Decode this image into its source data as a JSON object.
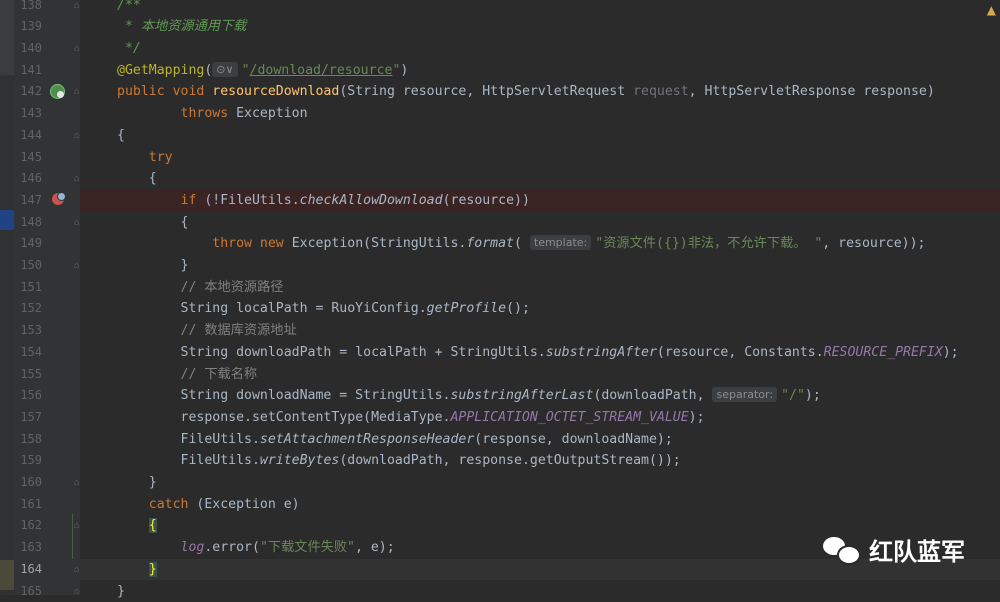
{
  "editor": {
    "lines": [
      {
        "n": "138",
        "html": "<span class=\"cmt\">/**</span>"
      },
      {
        "n": "139",
        "html": "<span class=\"cmt\"> * 本地资源通用下载</span>"
      },
      {
        "n": "140",
        "html": "<span class=\"cmt\"> */</span>"
      },
      {
        "n": "141",
        "html": "<span class=\"ann\">@GetMapping</span>(<span class=\"hint\">⊙∨</span><span class=\"str\">\"</span><span class=\"link\">/download/resource</span><span class=\"str\">\"</span>)"
      },
      {
        "n": "142",
        "html": "<span class=\"kw\">public void </span><span class=\"fn\">resourceDownload</span>(String resource, HttpServletRequest <span class=\"param\">request</span>, HttpServletResponse response)"
      },
      {
        "n": "143",
        "html": "        <span class=\"kw\">throws </span>Exception"
      },
      {
        "n": "144",
        "html": "{"
      },
      {
        "n": "145",
        "html": "    <span class=\"kw\">try</span>"
      },
      {
        "n": "146",
        "html": "    {"
      },
      {
        "n": "147",
        "html": "        <span class=\"kw\">if </span>(!FileUtils.<span class=\"it\">checkAllowDownload</span>(resource))"
      },
      {
        "n": "148",
        "html": "        {"
      },
      {
        "n": "149",
        "html": "            <span class=\"kw\">throw new </span>Exception(StringUtils.<span class=\"it\">format</span>( <span class=\"hint\">template:</span><span class=\"str\">\"资源文件({})非法，不允许下载。 \"</span>, resource));"
      },
      {
        "n": "150",
        "html": "        }"
      },
      {
        "n": "151",
        "html": "        <span class=\"lcmt\">// 本地资源路径</span>"
      },
      {
        "n": "152",
        "html": "        String localPath = RuoYiConfig.<span class=\"it\">getProfile</span>();"
      },
      {
        "n": "153",
        "html": "        <span class=\"lcmt\">// 数据库资源地址</span>"
      },
      {
        "n": "154",
        "html": "        String downloadPath = localPath + StringUtils.<span class=\"it\">substringAfter</span>(resource, Constants.<span class=\"const\">RESOURCE_PREFIX</span>);"
      },
      {
        "n": "155",
        "html": "        <span class=\"lcmt\">// 下载名称</span>"
      },
      {
        "n": "156",
        "html": "        String downloadName = StringUtils.<span class=\"it\">substringAfterLast</span>(downloadPath, <span class=\"hint\">separator:</span><span class=\"str\">\"/\"</span>);"
      },
      {
        "n": "157",
        "html": "        response.setContentType(MediaType.<span class=\"const\">APPLICATION_OCTET_STREAM_VALUE</span>);"
      },
      {
        "n": "158",
        "html": "        FileUtils.<span class=\"it\">setAttachmentResponseHeader</span>(response, downloadName);"
      },
      {
        "n": "159",
        "html": "        FileUtils.<span class=\"it\">writeBytes</span>(downloadPath, response.getOutputStream());"
      },
      {
        "n": "160",
        "html": "    }"
      },
      {
        "n": "161",
        "html": "    <span class=\"kw\">catch </span>(Exception e)"
      },
      {
        "n": "162",
        "html": "    <span class=\"brace-hl\">{</span>"
      },
      {
        "n": "163",
        "html": "        <span class=\"const\">log</span>.error(<span class=\"str\">\"下载文件失败\"</span>, e);"
      },
      {
        "n": "164",
        "html": "    <span class=\"brace-hl\">}</span>"
      },
      {
        "n": "165",
        "html": "}"
      }
    ]
  },
  "watermark": {
    "text": "红队蓝军",
    "icon": "wechat-icon"
  },
  "icons": {
    "warning": "▲",
    "breakpoint": "breakpoint-icon",
    "web_endpoint": "web-endpoint-icon"
  },
  "colors": {
    "background": "#2b2b2b",
    "gutter": "#313335",
    "keyword": "#cc7832",
    "string": "#6a8759",
    "annotation": "#bbb529",
    "breakpoint_row": "#3a2323"
  }
}
